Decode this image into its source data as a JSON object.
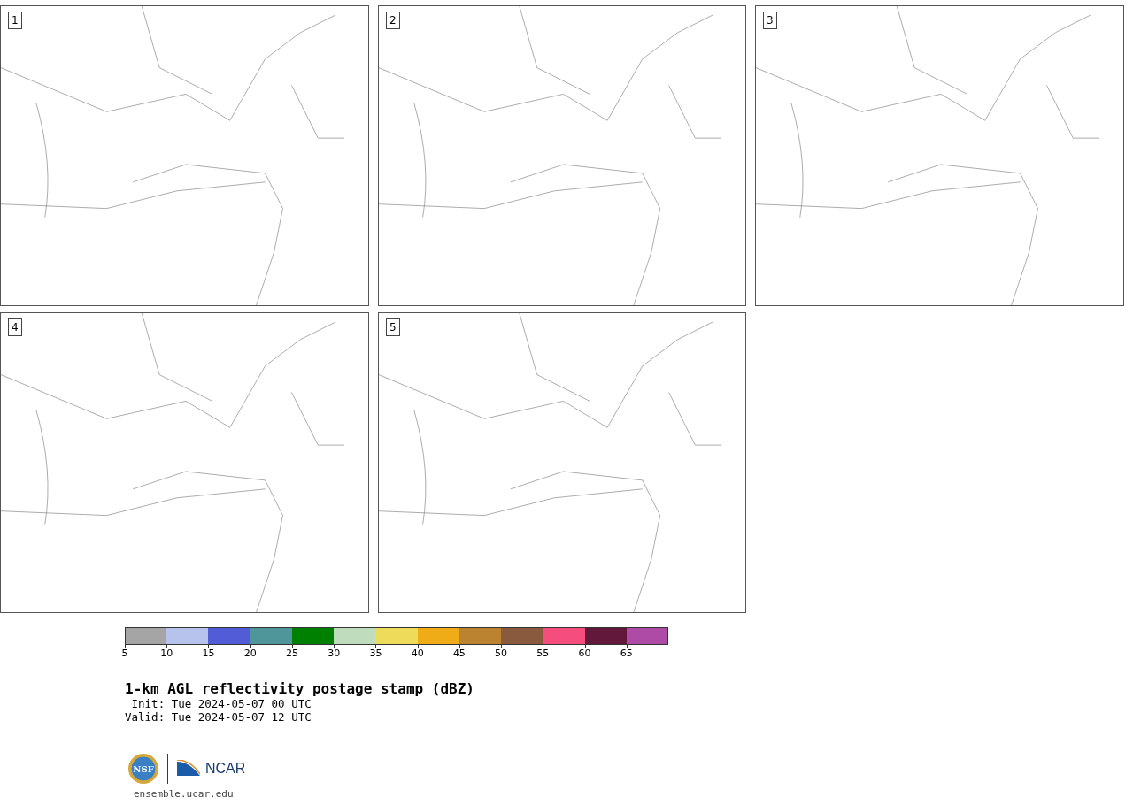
{
  "panels": [
    {
      "label": "1"
    },
    {
      "label": "2"
    },
    {
      "label": "3"
    },
    {
      "label": "4"
    },
    {
      "label": "5"
    }
  ],
  "colorbar": [
    {
      "label": "5",
      "color": "#a5a5a5"
    },
    {
      "label": "10",
      "color": "#b7c3ec"
    },
    {
      "label": "15",
      "color": "#525cd6"
    },
    {
      "label": "20",
      "color": "#4f969b"
    },
    {
      "label": "25",
      "color": "#008000"
    },
    {
      "label": "30",
      "color": "#bfdcbd"
    },
    {
      "label": "35",
      "color": "#efdb5a"
    },
    {
      "label": "40",
      "color": "#efac17"
    },
    {
      "label": "45",
      "color": "#bb8330"
    },
    {
      "label": "50",
      "color": "#8a5a3e"
    },
    {
      "label": "55",
      "color": "#f54e7e"
    },
    {
      "label": "60",
      "color": "#62183a"
    },
    {
      "label": "65",
      "color": "#ad4ba6"
    }
  ],
  "title": "1-km AGL reflectivity postage stamp (dBZ)",
  "init": " Init: Tue 2024-05-07 00 UTC",
  "valid": "Valid: Tue 2024-05-07 12 UTC",
  "logos": {
    "nsf": "NSF",
    "ncar": "NCAR"
  },
  "url": "ensemble.ucar.edu"
}
